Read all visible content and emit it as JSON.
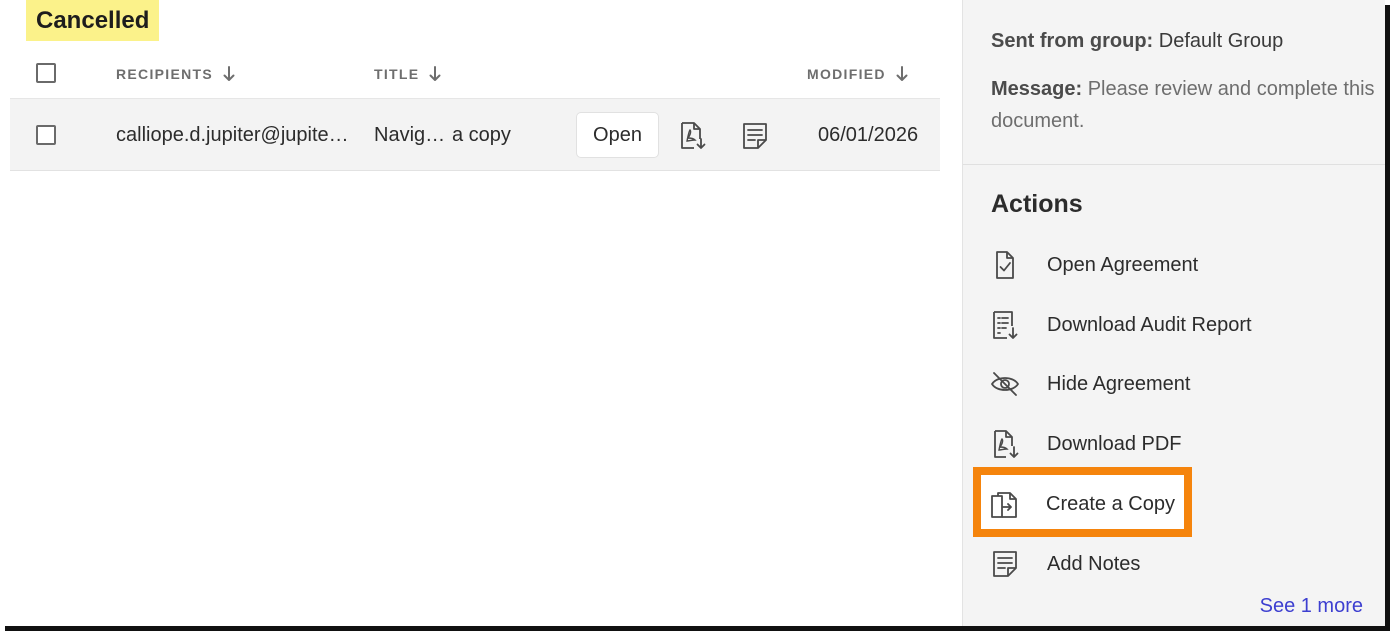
{
  "status": {
    "label": "Cancelled"
  },
  "table": {
    "columns": [
      {
        "label": "RECIPIENTS"
      },
      {
        "label": "TITLE"
      },
      {
        "label": "MODIFIED"
      }
    ],
    "rows": [
      {
        "recipient": "calliope.d.jupiter@jupite…",
        "title_start": "Navig…",
        "title_end": "a copy",
        "open_label": "Open",
        "modified": "06/01/2026"
      }
    ]
  },
  "details": {
    "sent_from_label": "Sent from group:",
    "sent_from_value": "Default Group",
    "message_label": "Message:",
    "message_value_line1": "Please review and complete this",
    "message_value_line2": "document."
  },
  "actions": {
    "title": "Actions",
    "items": [
      {
        "label": "Open Agreement",
        "icon": "document-check-icon"
      },
      {
        "label": "Download Audit Report",
        "icon": "audit-report-download-icon"
      },
      {
        "label": "Hide Agreement",
        "icon": "eye-hidden-icon"
      },
      {
        "label": "Download PDF",
        "icon": "pdf-download-icon"
      },
      {
        "label": "Create a Copy",
        "icon": "copy-document-icon"
      },
      {
        "label": "Add Notes",
        "icon": "notes-icon"
      }
    ],
    "see_more": "See 1 more"
  },
  "colors": {
    "status_highlight": "#fbf28a",
    "callout_border": "#f5840c",
    "link": "#3d3fd0",
    "panel_bg": "#f4f4f4",
    "row_bg": "#f3f3f3"
  }
}
